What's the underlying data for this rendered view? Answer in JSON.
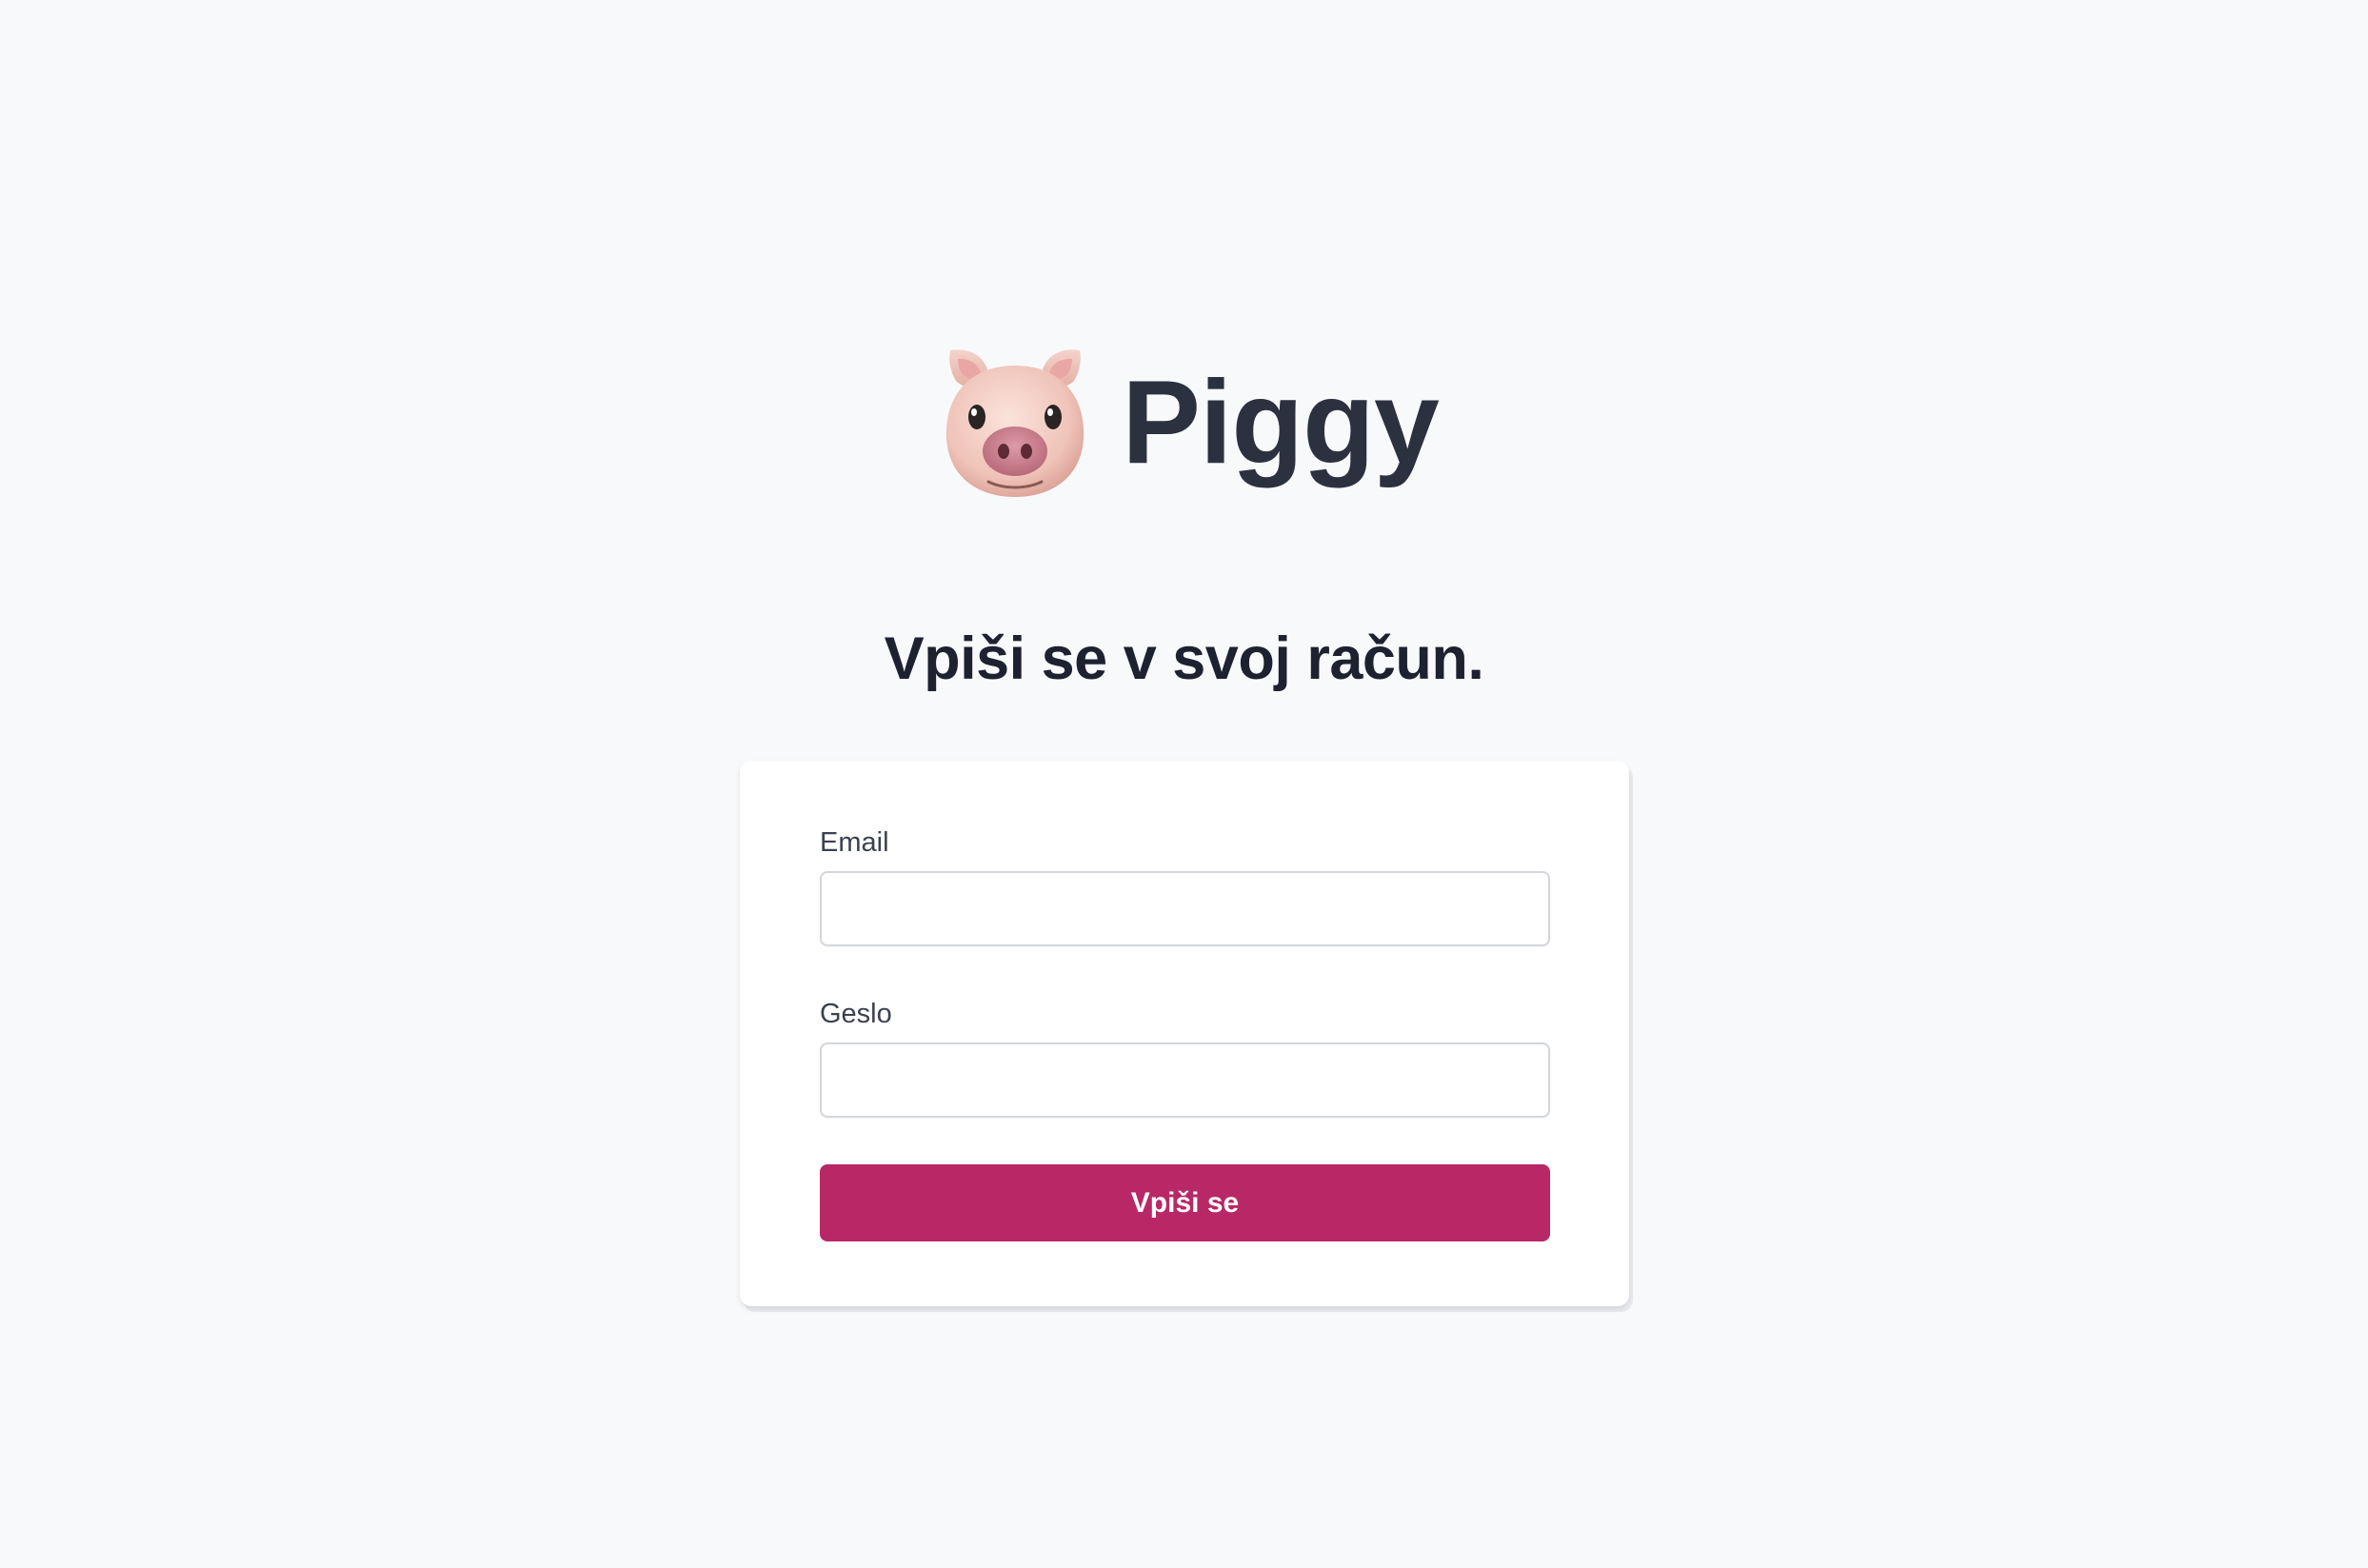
{
  "brand": {
    "logo_icon": "pig-face-icon",
    "name": "Piggy"
  },
  "login": {
    "title": "Vpiši se v svoj račun.",
    "email": {
      "label": "Email",
      "value": "",
      "placeholder": ""
    },
    "password": {
      "label": "Geslo",
      "value": "",
      "placeholder": ""
    },
    "submit_label": "Vpiši se"
  },
  "colors": {
    "background": "#f8f9fb",
    "card": "#ffffff",
    "primary_button": "#b82866",
    "heading_text": "#1d2130",
    "brand_text": "#2c3140"
  }
}
